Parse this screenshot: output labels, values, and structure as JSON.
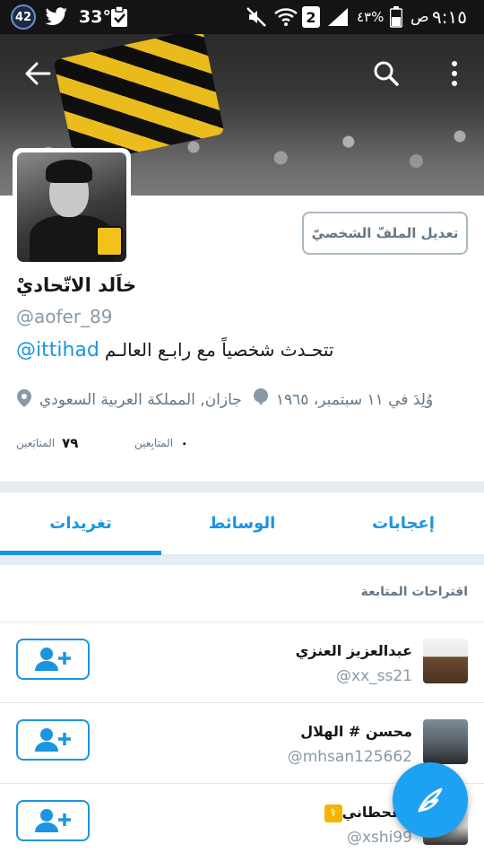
{
  "status_bar": {
    "notification_count": "42",
    "temperature": "33°",
    "battery_percent": "٤٣%",
    "sim_slot": "2",
    "ampm": "ص",
    "time": "٩:١٥"
  },
  "profile": {
    "edit_profile_label": "تعديل الملفّ الشخصيّ",
    "name": "خاَلد الاتّحاديْ",
    "handle": "@aofer_89",
    "bio_text": "تتحـدث شخصياً مع رابـع العالـم",
    "bio_mention": "@ittihad",
    "birthday": "وُلِدَ في ١١ سبتمبر، ١٩٦٥",
    "location": "جازان, المملكة العربية السعودي",
    "following_count": "٧٩",
    "following_label": "المتابَعين",
    "followers_count": "٠",
    "followers_label": "المتابِعين"
  },
  "tabs": [
    {
      "label": "تغريدات",
      "active": true
    },
    {
      "label": "الوسائط",
      "active": false
    },
    {
      "label": "إعجابات",
      "active": false
    }
  ],
  "suggestions": {
    "title": "اقتراحات المتابعة",
    "items": [
      {
        "name": "عبدالعزيز العنزي",
        "handle": "@xx_ss21"
      },
      {
        "name": "محسن # الهلال",
        "handle": "@mhsan125662"
      },
      {
        "name": "القحطاني",
        "handle": "@xshi99"
      }
    ]
  },
  "colors": {
    "accent": "#1b95e0",
    "fab": "#1da1f2",
    "muted": "#8899a6"
  },
  "icons": {
    "back": "arrow-left-icon",
    "search": "search-icon",
    "more": "more-vertical-icon",
    "follow": "add-user-icon",
    "compose": "compose-icon"
  }
}
